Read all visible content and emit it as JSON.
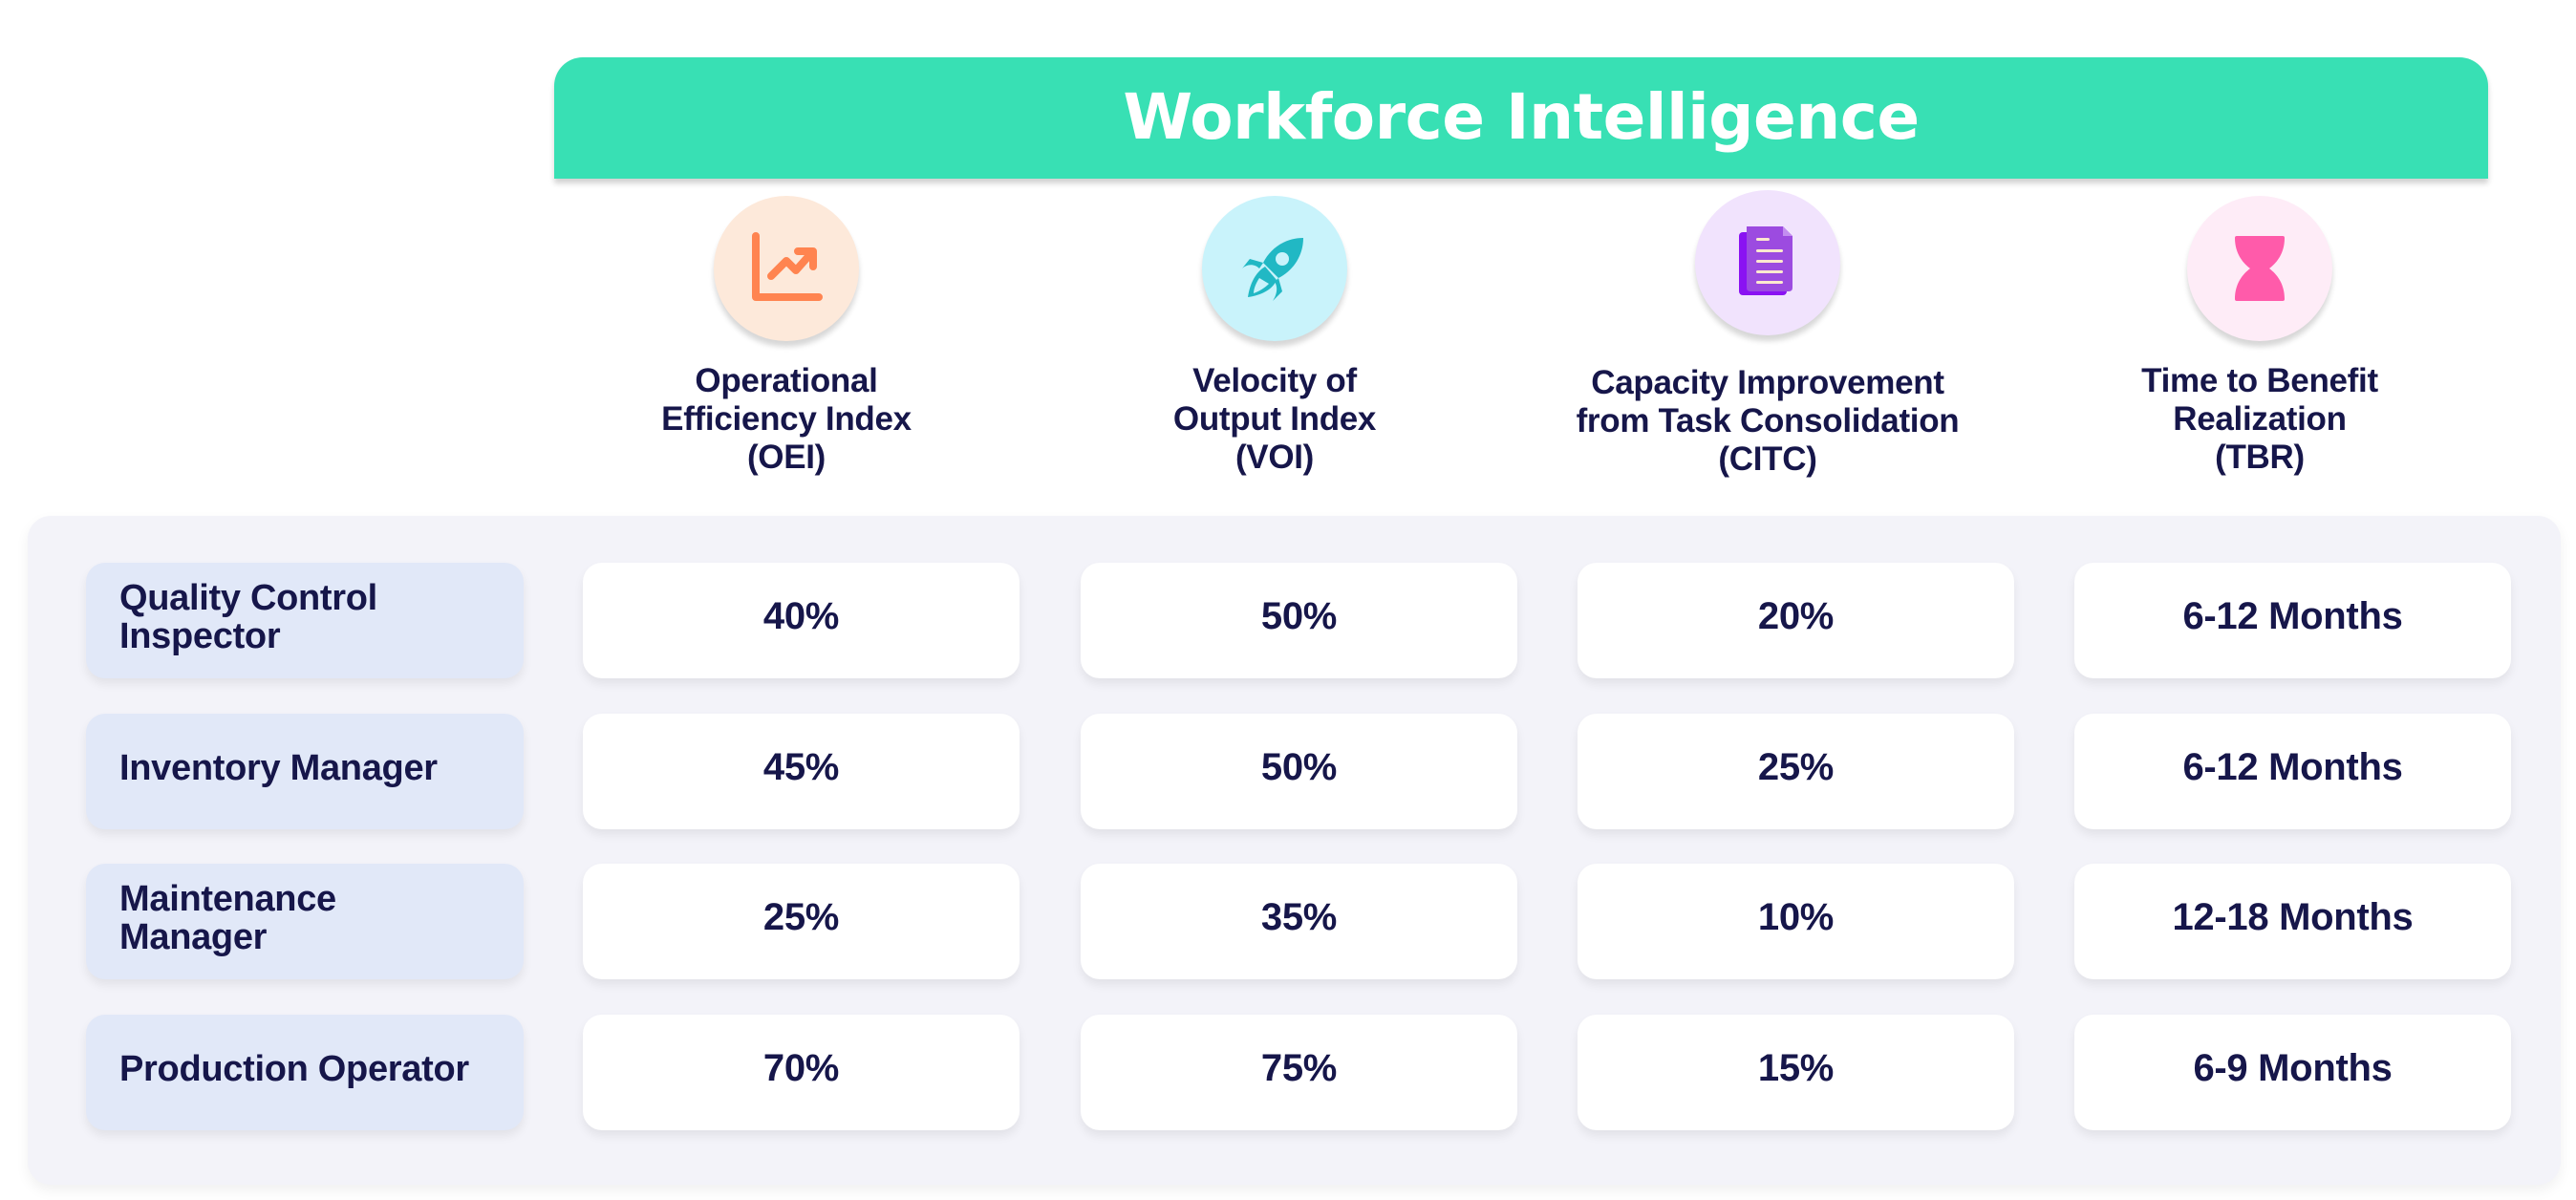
{
  "header": {
    "title": "Workforce Intelligence",
    "accent_color": "#38E0B4"
  },
  "metrics": [
    {
      "label": "Operational\nEfficiency Index\n(OEI)",
      "icon": "trending-up-chart-icon",
      "icon_color": "#FF8450",
      "circle_color": "#FDE9DA"
    },
    {
      "label": "Velocity of\nOutput Index\n(VOI)",
      "icon": "rocket-icon",
      "icon_color": "#21B8C4",
      "circle_color": "#C9F3FB"
    },
    {
      "label": "Capacity Improvement\nfrom Task Consolidation\n(CITC)",
      "icon": "document-icon",
      "icon_color": "#9C4BE0",
      "circle_color": "#F1E3FD"
    },
    {
      "label": "Time to Benefit\nRealization\n(TBR)",
      "icon": "hourglass-icon",
      "icon_color": "#FF5BAA",
      "circle_color": "#FEECF7"
    }
  ],
  "rows": [
    {
      "role": "Quality Control\nInspector",
      "values": [
        "40%",
        "50%",
        "20%",
        "6-12 Months"
      ]
    },
    {
      "role": "Inventory Manager",
      "values": [
        "45%",
        "50%",
        "25%",
        "6-12 Months"
      ]
    },
    {
      "role": "Maintenance\nManager",
      "values": [
        "25%",
        "35%",
        "10%",
        "12-18 Months"
      ]
    },
    {
      "role": "Production Operator",
      "values": [
        "70%",
        "75%",
        "15%",
        "6-9 Months"
      ]
    }
  ]
}
